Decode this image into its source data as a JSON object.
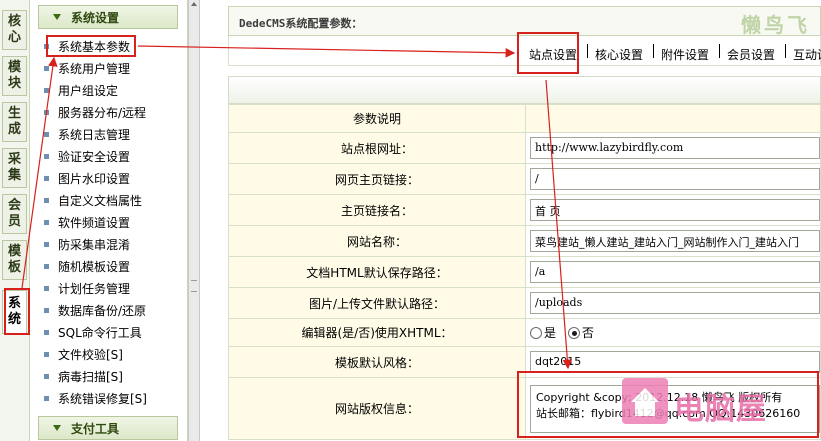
{
  "vtabs": [
    "核心",
    "模块",
    "生成",
    "采集",
    "会员",
    "模板",
    "系统"
  ],
  "sidebar": {
    "section_title": "系统设置",
    "items": [
      "系统基本参数",
      "系统用户管理",
      "用户组设定",
      "服务器分布/远程",
      "系统日志管理",
      "验证安全设置",
      "图片水印设置",
      "自定义文档属性",
      "软件频道设置",
      "防采集串混淆",
      "随机模板设置",
      "计划任务管理",
      "数据库备份/还原",
      "SQL命令行工具",
      "文件校验[S]",
      "病毒扫描[S]",
      "系统错误修复[S]"
    ],
    "section2_title": "支付工具"
  },
  "header": {
    "title": "DedeCMS系统配置参数：",
    "logo": "懒鸟飞"
  },
  "tabs": [
    "站点设置",
    "核心设置",
    "附件设置",
    "会员设置",
    "互动设"
  ],
  "form": {
    "header_label": "参数说明",
    "rows": [
      {
        "label": "站点根网址：",
        "value": "http://www.lazybirdfly.com"
      },
      {
        "label": "网页主页链接：",
        "value": "/"
      },
      {
        "label": "主页链接名：",
        "value": "首 页"
      },
      {
        "label": "网站名称：",
        "value": "菜鸟建站_懒人建站_建站入门_网站制作入门_建站入门"
      },
      {
        "label": "文档HTML默认保存路径：",
        "value": "/a"
      },
      {
        "label": "图片/上传文件默认路径：",
        "value": "/uploads"
      }
    ],
    "editor_row": {
      "label": "编辑器(是/否)使用XHTML：",
      "option_yes": "是",
      "option_no": "否",
      "selected": "否"
    },
    "style_row": {
      "label": "模板默认风格：",
      "value": "dqt2015"
    },
    "copyright_row": {
      "label": "网站版权信息：",
      "line1": "Copyright &copy; 2012.12.18 懒鸟飞 版权所有",
      "line2": "站长邮箱：flybird1412@qq.com QQ:1430626160"
    }
  },
  "watermark": {
    "text": "电脑屋"
  },
  "colors": {
    "annotation": "#d8201c",
    "label_bg": "#fffbe7",
    "menu_accent": "#2f4a10"
  }
}
